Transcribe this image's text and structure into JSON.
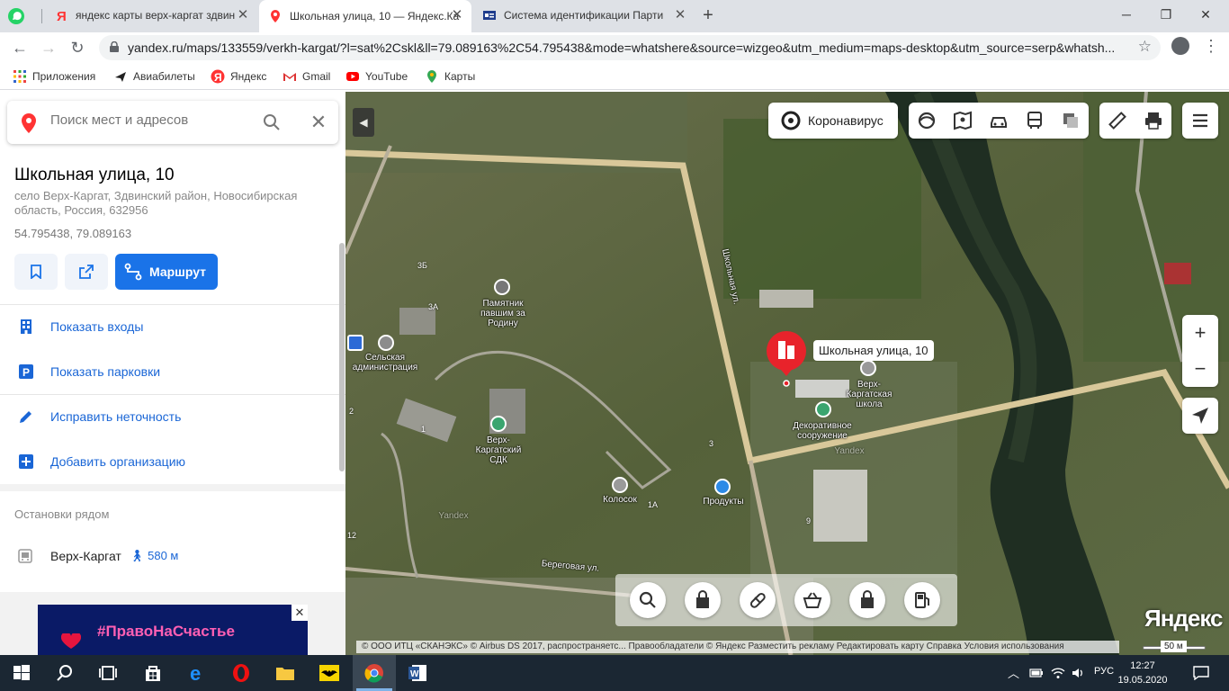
{
  "browser": {
    "tabs": [
      {
        "title": "яндекс карты верх-каргат здвин",
        "active": false
      },
      {
        "title": "Школьная улица, 10 — Яндекс.Ка",
        "active": true
      },
      {
        "title": "Система идентификации Парти",
        "active": false
      }
    ],
    "url": "yandex.ru/maps/133559/verkh-kargat/?l=sat%2Cskl&ll=79.089163%2C54.795438&mode=whatshere&source=wizgeo&utm_medium=maps-desktop&utm_source=serp&whatsh...",
    "bookmarks": [
      "Приложения",
      "Авиабилеты",
      "Яндекс",
      "Gmail",
      "YouTube",
      "Карты"
    ]
  },
  "sidebar": {
    "search_placeholder": "Поиск мест и адресов",
    "title": "Школьная улица, 10",
    "address": "село Верх-Каргат, Здвинский район, Новосибирская область, Россия, 632956",
    "coords": "54.795438, 79.089163",
    "route_label": "Маршрут",
    "items": [
      {
        "label": "Показать входы"
      },
      {
        "label": "Показать парковки"
      },
      {
        "label": "Исправить неточность"
      },
      {
        "label": "Добавить организацию"
      }
    ],
    "stops_heading": "Остановки рядом",
    "stop": {
      "name": "Верх-Каргат",
      "distance": "580 м"
    },
    "ad_text": "#ПравоНаСчастье"
  },
  "map": {
    "corona_label": "Коронавирус",
    "marker_label": "Школьная улица, 10",
    "labels": {
      "monument": "Памятник павшим за Родину",
      "admin": "Сельская администрация",
      "sdk": "Верх-Каргатский СДК",
      "kolosok": "Колосок",
      "products": "Продукты",
      "school": "Верх-Каргатская школа",
      "decor": "Декоративное сооружение",
      "street_school": "Школьная ул.",
      "street_bereg": "Береговая ул.",
      "watermark1": "Yandex",
      "watermark2": "Yandex"
    },
    "house_numbers": [
      "3Б",
      "3А",
      "2",
      "1",
      "3",
      "1А",
      "9",
      "12"
    ],
    "copyright": "© ООО ИТЦ «СКАНЭКС» © Airbus DS 2017, распространяетс...   Правообладатели     © Яндекс   Разместить рекламу   Редактировать карту   Справка   Условия использования",
    "logo": "Яндекс",
    "scale": "50 м"
  },
  "taskbar": {
    "lang": "РУС",
    "time": "12:27",
    "date": "19.05.2020"
  }
}
